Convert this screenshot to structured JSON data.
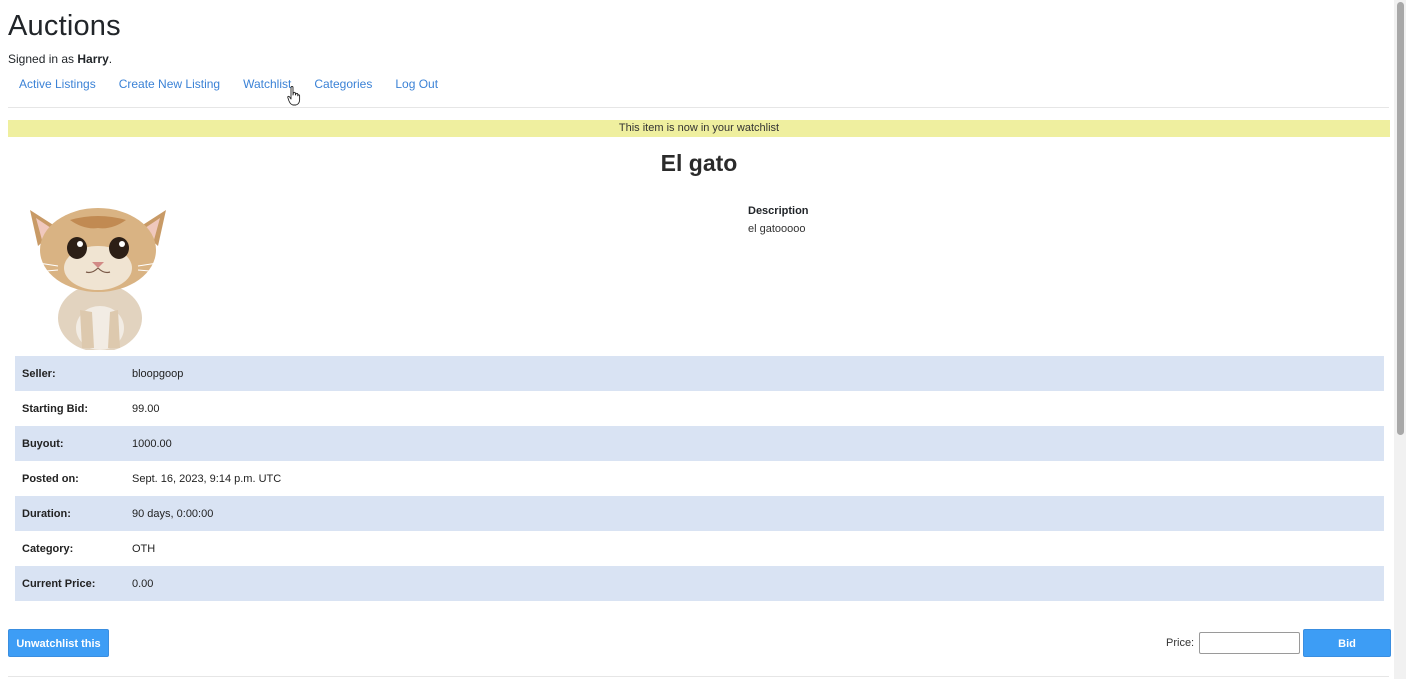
{
  "header": {
    "site_title": "Auctions",
    "signed_in_prefix": "Signed in as ",
    "username": "Harry",
    "signed_in_suffix": "."
  },
  "nav": {
    "items": [
      {
        "label": "Active Listings"
      },
      {
        "label": "Create New Listing"
      },
      {
        "label": "Watchlist"
      },
      {
        "label": "Categories"
      },
      {
        "label": "Log Out"
      }
    ]
  },
  "alert": {
    "message": "This item is now in your watchlist",
    "color": "#efef9f"
  },
  "listing": {
    "title": "El gato",
    "image_icon": "kitten-photo",
    "description_heading": "Description",
    "description": "el gatooooo",
    "details": [
      {
        "key": "Seller:",
        "value": "bloopgoop"
      },
      {
        "key": "Starting Bid:",
        "value": "99.00"
      },
      {
        "key": "Buyout:",
        "value": "1000.00"
      },
      {
        "key": "Posted on:",
        "value": "Sept. 16, 2023, 9:14 p.m. UTC"
      },
      {
        "key": "Duration:",
        "value": "90 days, 0:00:00"
      },
      {
        "key": "Category:",
        "value": "OTH"
      },
      {
        "key": "Current Price:",
        "value": "0.00"
      }
    ]
  },
  "actions": {
    "unwatch_label": "Unwatchlist this",
    "price_label": "Price:",
    "price_value": "",
    "bid_label": "Bid",
    "button_color": "#3d9df5",
    "row_shade_color": "#d9e3f3"
  }
}
